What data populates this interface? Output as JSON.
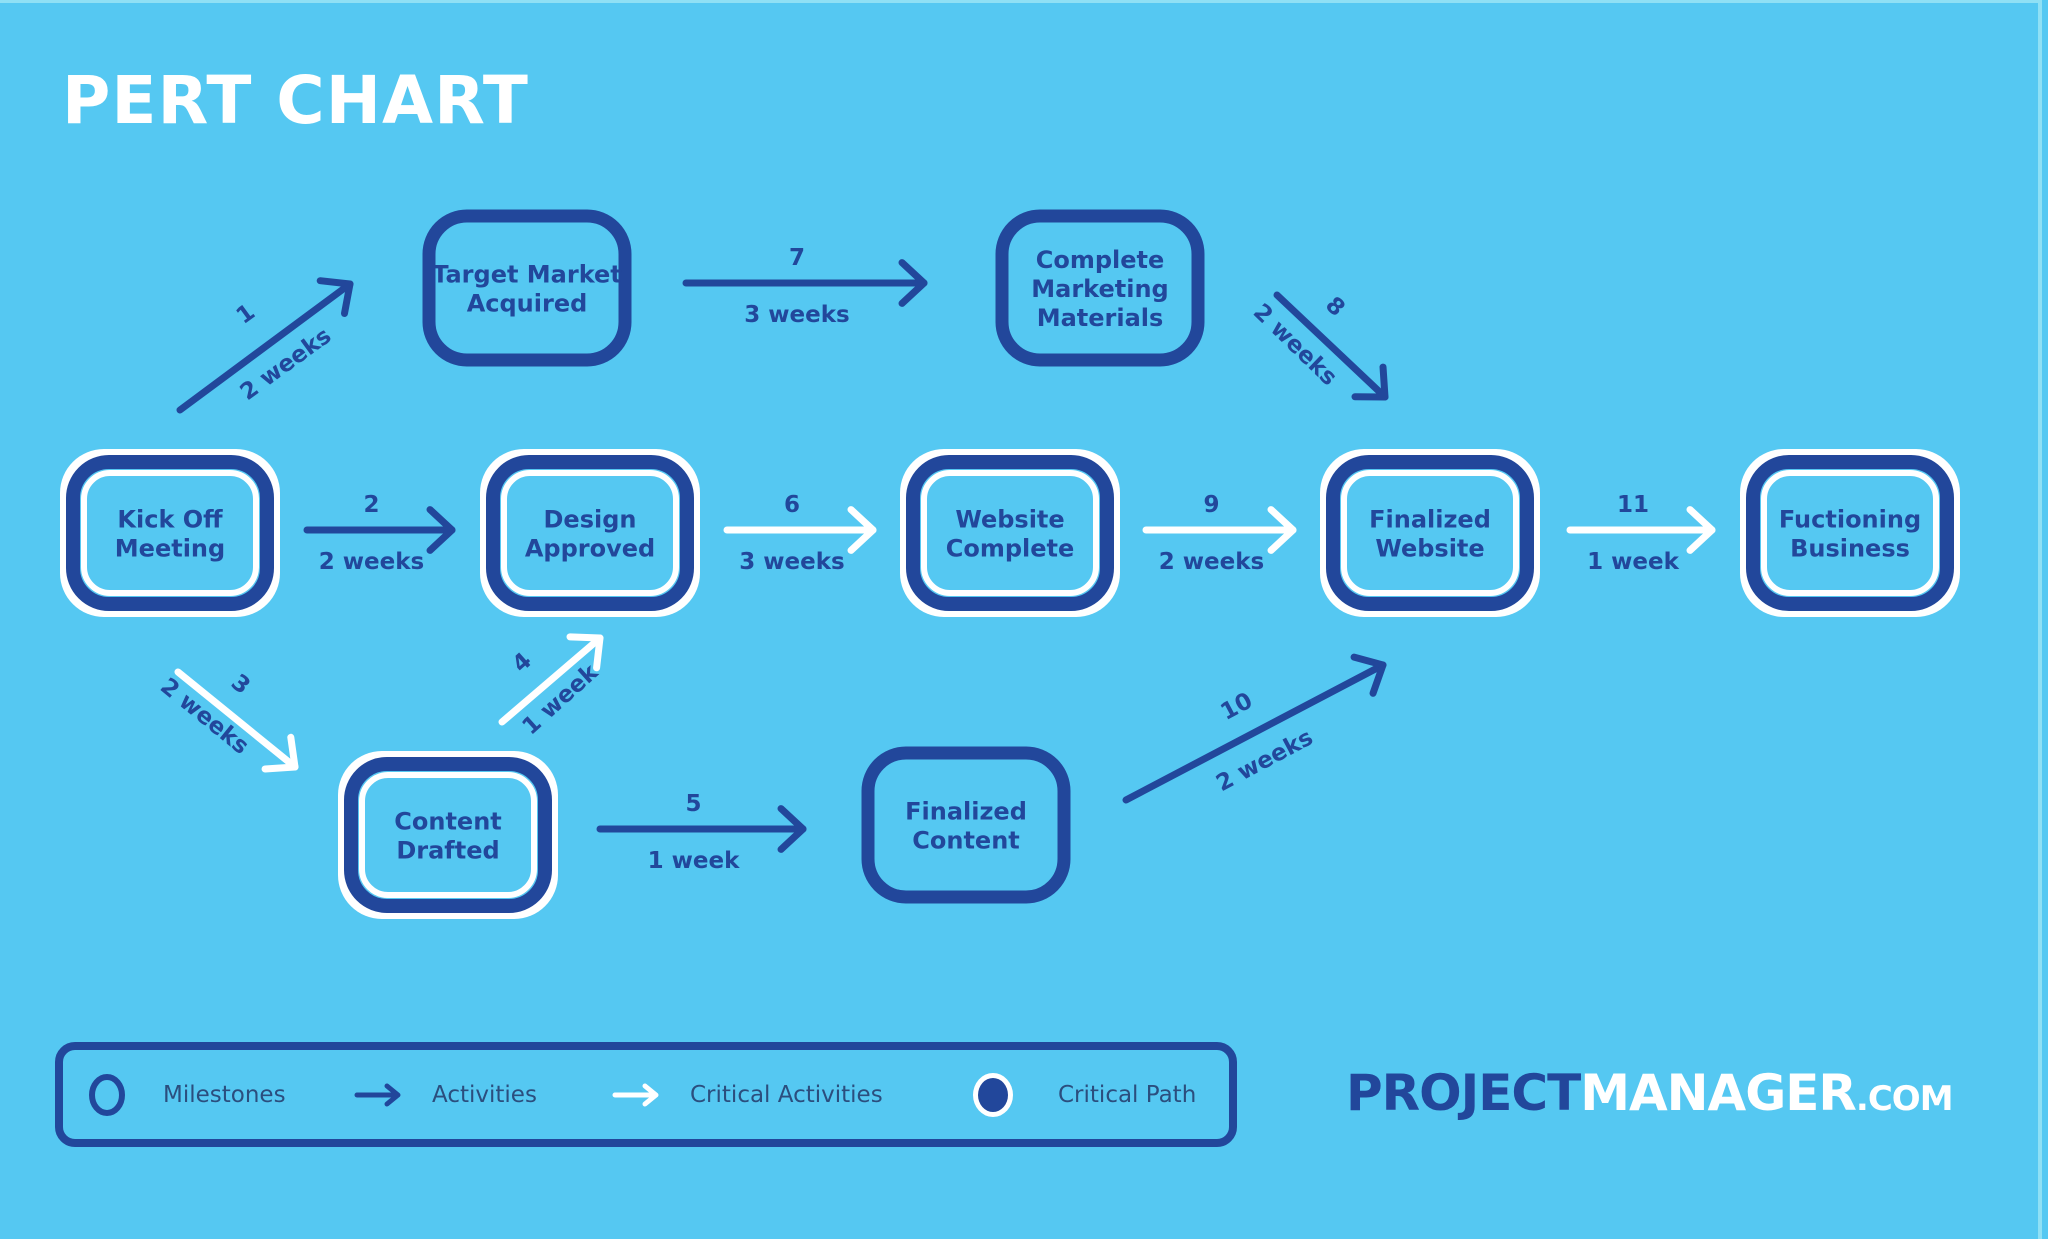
{
  "title": "PERT CHART",
  "colors": {
    "background": "#55C8F2",
    "navy": "#22479B",
    "white": "#FFFFFF"
  },
  "nodes": [
    {
      "id": "kickoff",
      "lines": [
        "Kick Off",
        "Meeting"
      ],
      "critical": true
    },
    {
      "id": "target",
      "lines": [
        "Target Market",
        "Acquired"
      ],
      "critical": false
    },
    {
      "id": "design",
      "lines": [
        "Design",
        "Approved"
      ],
      "critical": true
    },
    {
      "id": "marketing",
      "lines": [
        "Complete",
        "Marketing",
        "Materials"
      ],
      "critical": false
    },
    {
      "id": "website",
      "lines": [
        "Website",
        "Complete"
      ],
      "critical": true
    },
    {
      "id": "finalweb",
      "lines": [
        "Finalized",
        "Website"
      ],
      "critical": true
    },
    {
      "id": "business",
      "lines": [
        "Fuctioning",
        "Business"
      ],
      "critical": true
    },
    {
      "id": "content",
      "lines": [
        "Content",
        "Drafted"
      ],
      "critical": true
    },
    {
      "id": "finalcontent",
      "lines": [
        "Finalized",
        "Content"
      ],
      "critical": false
    }
  ],
  "activities": [
    {
      "number": "1",
      "duration": "2 weeks",
      "from": "kickoff",
      "to": "target",
      "critical": false
    },
    {
      "number": "2",
      "duration": "2 weeks",
      "from": "kickoff",
      "to": "design",
      "critical": false
    },
    {
      "number": "3",
      "duration": "2 weeks",
      "from": "kickoff",
      "to": "content",
      "critical": true
    },
    {
      "number": "4",
      "duration": "1 week",
      "from": "content",
      "to": "design",
      "critical": true
    },
    {
      "number": "5",
      "duration": "1 week",
      "from": "content",
      "to": "finalcontent",
      "critical": false
    },
    {
      "number": "6",
      "duration": "3 weeks",
      "from": "design",
      "to": "website",
      "critical": true
    },
    {
      "number": "7",
      "duration": "3 weeks",
      "from": "target",
      "to": "marketing",
      "critical": false
    },
    {
      "number": "8",
      "duration": "2 weeks",
      "from": "marketing",
      "to": "finalweb",
      "critical": false
    },
    {
      "number": "9",
      "duration": "2 weeks",
      "from": "website",
      "to": "finalweb",
      "critical": true
    },
    {
      "number": "10",
      "duration": "2 weeks",
      "from": "finalcontent",
      "to": "finalweb",
      "critical": false
    },
    {
      "number": "11",
      "duration": "1 week",
      "from": "finalweb",
      "to": "business",
      "critical": true
    }
  ],
  "legend": {
    "items": [
      {
        "icon": "milestone-circle-icon",
        "label": "Milestones"
      },
      {
        "icon": "activity-arrow-icon",
        "label": "Activities"
      },
      {
        "icon": "critical-activity-arrow-icon",
        "label": "Critical Activities"
      },
      {
        "icon": "critical-path-dot-icon",
        "label": "Critical Path"
      }
    ]
  },
  "logo": {
    "part1": "PROJECT",
    "part2": "MANAGER",
    "part3": ".COM"
  }
}
